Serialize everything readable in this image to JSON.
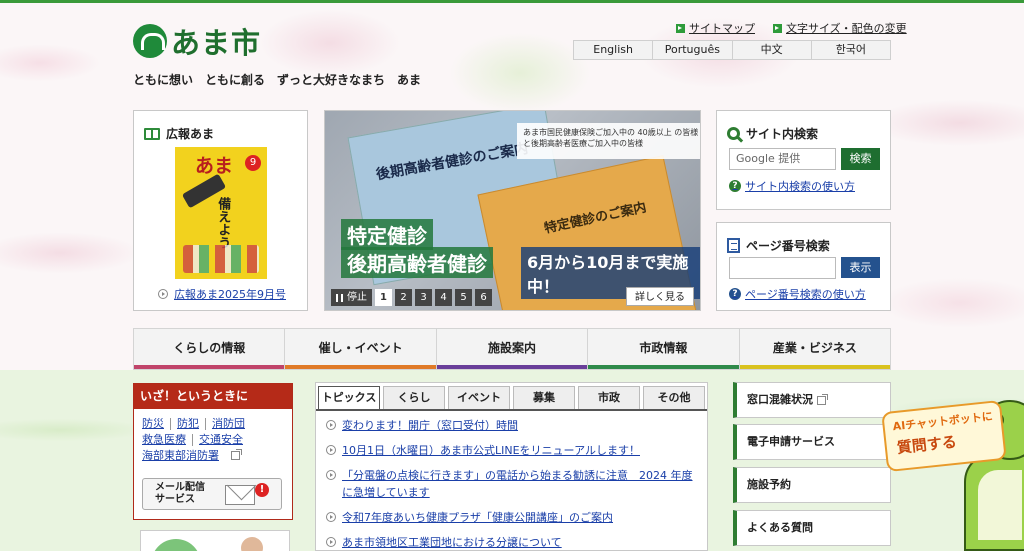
{
  "header": {
    "logo_text": "あま市",
    "tagline": "ともに想い　ともに創る　ずっと大好きなまち　あま",
    "util_links": [
      "サイトマップ",
      "文字サイズ・配色の変更"
    ],
    "languages": [
      "English",
      "Português",
      "中文",
      "한국어"
    ]
  },
  "koho": {
    "title": "広報あま",
    "cover_title": "あま",
    "cover_num": "9",
    "cover_text": "備えよう",
    "link": "広報あま2025年9月号"
  },
  "slideshow": {
    "notice": "あま市国民健康保険ご加入中の 40歳以上 の皆様と後期高齢者医療ご加入中の皆様",
    "env_blue_title": "後期高齢者健診のご案内",
    "env_orange_title": "特定健診のご案内",
    "big1": "特定健診",
    "big2": "後期高齢者健診",
    "big3": "6月から10月まで実施中！",
    "stop_label": "停止",
    "pages": [
      "1",
      "2",
      "3",
      "4",
      "5",
      "6"
    ],
    "active_page": "1",
    "more_label": "詳しく見る"
  },
  "site_search": {
    "title": "サイト内検索",
    "placeholder": "Google 提供",
    "button": "検索",
    "help": "サイト内検索の使い方"
  },
  "page_search": {
    "title": "ページ番号検索",
    "button": "表示",
    "help": "ページ番号検索の使い方"
  },
  "gnav": [
    {
      "label": "くらしの情報",
      "color": "#c0446a"
    },
    {
      "label": "催し・イベント",
      "color": "#e07a28"
    },
    {
      "label": "施設案内",
      "color": "#6a3f9a"
    },
    {
      "label": "市政情報",
      "color": "#2f8a4a"
    },
    {
      "label": "産業・ビジネス",
      "color": "#d9c21e"
    }
  ],
  "emergency": {
    "title": "いざ！というときに",
    "links": [
      "防災",
      "防犯",
      "消防団",
      "救急医療",
      "交通安全",
      "海部東部消防署"
    ],
    "mail_label_1": "メール配信",
    "mail_label_2": "サービス",
    "alert": "!"
  },
  "topics": {
    "tabs": [
      "トピックス",
      "くらし",
      "イベント",
      "募集",
      "市政",
      "その他"
    ],
    "active_tab": "トピックス",
    "items": [
      "変わります！開庁（窓口受付）時間",
      "10月1日（水曜日）あま市公式LINEをリニューアルします！",
      "「分電盤の点検に行きます」の電話から始まる勧誘に注意　2024 年度に急増しています",
      "令和7年度あいち健康プラザ「健康公開講座」のご案内",
      "あま市領地区工業団地における分譲について"
    ]
  },
  "services": [
    "窓口混雑状況",
    "電子申請サービス",
    "施設予約",
    "よくある質問"
  ],
  "chatbot": {
    "line1": "AIチャットボットに",
    "line2": "質問する"
  }
}
